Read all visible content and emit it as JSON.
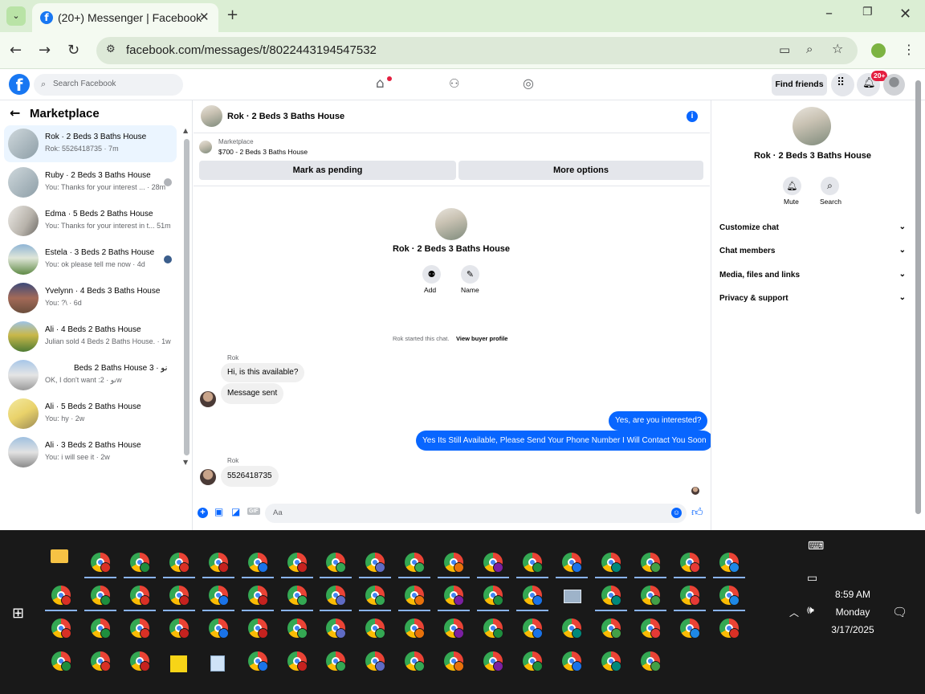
{
  "browser": {
    "tab_title": "(20+) Messenger | Facebook",
    "url": "facebook.com/messages/t/8022443194547532"
  },
  "fb_header": {
    "search_placeholder": "Search Facebook",
    "find_friends": "Find friends",
    "notif_badge": "20+"
  },
  "left_panel": {
    "title": "Marketplace",
    "conversations": [
      {
        "title": "Rok · 2 Beds 3 Baths House",
        "preview": "Rok: 5526418735 · 7m"
      },
      {
        "title": "Ruby · 2 Beds 3 Baths House",
        "preview": "You: Thanks for your interest ... · 28m"
      },
      {
        "title": "Edma · 5 Beds 2 Baths House",
        "preview": "You: Thanks for your interest in t... 51m"
      },
      {
        "title": "Estela · 3 Beds 2 Baths House",
        "preview": "You: ok please tell me now · 4d"
      },
      {
        "title": "Yvelynn · 4 Beds 3 Baths House",
        "preview": "You: ?\\ · 6d"
      },
      {
        "title": "Ali · 4 Beds 2 Baths House",
        "preview": "Julian sold 4 Beds 2 Baths House. · 1w"
      },
      {
        "title": "Beds 2 Baths House 3 · نو",
        "preview": "OK, I don't want :نو · 2w"
      },
      {
        "title": "Ali · 5 Beds 2 Baths House",
        "preview": "You: hy · 2w"
      },
      {
        "title": "Ali · 3 Beds 2 Baths House",
        "preview": "You: i will see it · 2w"
      }
    ]
  },
  "chat": {
    "header_title": "Rok · 2 Beds 3 Baths House",
    "marketplace_label": "Marketplace",
    "listing": "$700 - 2 Beds 3 Baths House",
    "mark_pending": "Mark as pending",
    "more_options": "More options",
    "center_title": "Rok · 2 Beds 3 Baths House",
    "add_label": "Add",
    "name_label": "Name",
    "started_text": "Rok started this chat.",
    "view_profile": "View buyer profile",
    "sender_1": "Rok",
    "msg_1": "Hi, is this available?",
    "msg_2": "Message sent",
    "msg_3": "Yes, are you interested?",
    "msg_4": "Yes Its Still Available, Please Send Your Phone Number I Will Contact You Soon",
    "sender_2": "Rok",
    "msg_5": "5526418735",
    "composer_placeholder": "Aa"
  },
  "right_panel": {
    "title": "Rok · 2 Beds 3 Baths House",
    "mute": "Mute",
    "search": "Search",
    "items": [
      "Customize chat",
      "Chat members",
      "Media, files and links",
      "Privacy & support"
    ]
  },
  "taskbar": {
    "time": "8:59 AM",
    "day": "Monday",
    "date": "3/17/2025"
  },
  "colors": {
    "fb_blue": "#1877f2",
    "messenger_blue": "#0866ff",
    "badge_red": "#e41e3f",
    "chrome_green": "#dbeed4"
  }
}
